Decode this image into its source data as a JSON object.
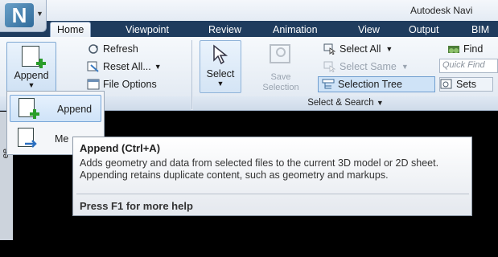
{
  "app": {
    "title": "Autodesk Navi",
    "logo_letter": "N"
  },
  "tabs": [
    "Home",
    "Viewpoint",
    "Review",
    "Animation",
    "View",
    "Output",
    "BIM"
  ],
  "project_group": {
    "append_label": "Append",
    "refresh_label": "Refresh",
    "reset_all_label": "Reset All...",
    "file_options_label": "File Options",
    "group_label_partial": "ct"
  },
  "select_group": {
    "select_label": "Select",
    "save_selection_label_1": "Save",
    "save_selection_label_2": "Selection",
    "select_all_label": "Select All",
    "select_same_label": "Select Same",
    "selection_tree_label": "Selection Tree",
    "quick_find_placeholder": "Quick Find",
    "sets_label": "Sets",
    "find_label": "Find",
    "group_label": "Select & Search"
  },
  "side_strip_text": "ee",
  "dropdown": {
    "items": [
      {
        "label": "Append",
        "highlighted": true
      },
      {
        "label": "Me",
        "highlighted": false
      }
    ]
  },
  "tooltip": {
    "title": "Append (Ctrl+A)",
    "body": "Adds geometry and data from selected files to the current 3D model or 2D sheet. Appending retains duplicate content, such as geometry and markups.",
    "help": "Press F1 for more help"
  },
  "colors": {
    "tab_bar": "#1f3c5e",
    "accent_green": "#2a9d2a",
    "highlight_blue": "#cfe3f8"
  }
}
